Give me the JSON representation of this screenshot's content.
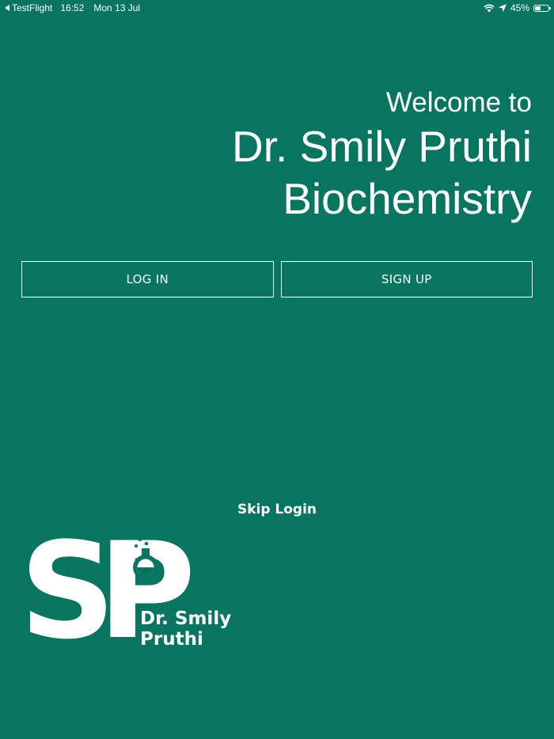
{
  "status_bar": {
    "back_app": "TestFlight",
    "time": "16:52",
    "date": "Mon 13 Jul",
    "battery_percent": "45%",
    "battery_level": 0.45,
    "icons": [
      "back-arrow-icon",
      "wifi-icon",
      "location-arrow-icon",
      "battery-icon"
    ]
  },
  "welcome": {
    "greeting": "Welcome to",
    "brand_line1": "Dr. Smily Pruthi",
    "brand_line2": "Biochemistry"
  },
  "buttons": {
    "login": "LOG IN",
    "signup": "SIGN UP",
    "skip": "Skip Login"
  },
  "logo": {
    "monogram": "SP",
    "text_line1": "Dr. Smily",
    "text_line2": "Pruthi",
    "icon": "flask-icon"
  },
  "colors": {
    "background": "#077560",
    "foreground": "#ffffff"
  }
}
